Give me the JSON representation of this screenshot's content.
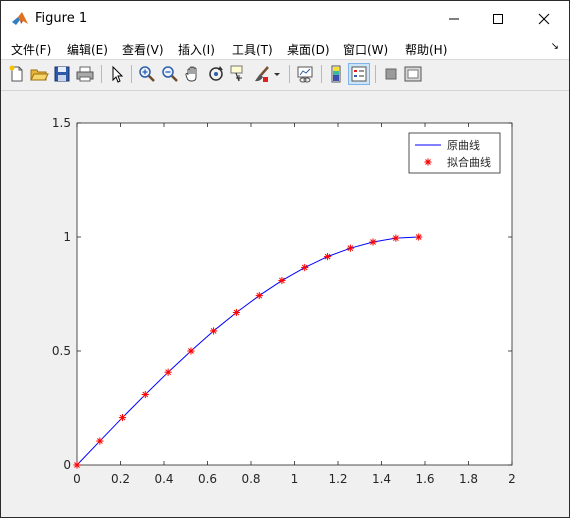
{
  "window": {
    "title": "Figure 1",
    "app_icon": "matlab-logo-icon",
    "controls": [
      "minimize-icon",
      "maximize-icon",
      "close-icon"
    ]
  },
  "menubar": {
    "items": [
      {
        "label": "文件(F)"
      },
      {
        "label": "编辑(E)"
      },
      {
        "label": "查看(V)"
      },
      {
        "label": "插入(I)"
      },
      {
        "label": "工具(T)"
      },
      {
        "label": "桌面(D)"
      },
      {
        "label": "窗口(W)"
      },
      {
        "label": "帮助(H)"
      }
    ],
    "dock_arrow": "↘"
  },
  "toolbar": {
    "buttons": [
      "new-figure-icon",
      "open-file-icon",
      "save-icon",
      "print-icon",
      "pointer-icon",
      "zoom-in-icon",
      "zoom-out-icon",
      "pan-hand-icon",
      "rotate-3d-icon",
      "data-cursor-icon",
      "brush-icon",
      "brush-dropdown-icon",
      "link-plot-icon",
      "colorbar-icon",
      "legend-icon",
      "hide-plot-tools-icon",
      "show-plot-tools-icon"
    ],
    "active_button": "legend-icon"
  },
  "colors": {
    "line": "#0000ff",
    "marker": "#ff0000",
    "axes_bg": "#ffffff",
    "figure_bg": "#f0f0f0"
  },
  "chart_data": {
    "type": "line",
    "title": "",
    "xlabel": "",
    "ylabel": "",
    "xlim": [
      0,
      2
    ],
    "ylim": [
      0,
      1.5
    ],
    "xticks": [
      "0",
      "0.2",
      "0.4",
      "0.6",
      "0.8",
      "1",
      "1.2",
      "1.4",
      "1.6",
      "1.8",
      "2"
    ],
    "yticks": [
      "0",
      "0.5",
      "1",
      "1.5"
    ],
    "grid": false,
    "legend_position": "top-right",
    "series": [
      {
        "name": "原曲线",
        "style": "line",
        "color": "#0000ff",
        "x": [
          0,
          0.105,
          0.209,
          0.314,
          0.419,
          0.524,
          0.628,
          0.733,
          0.838,
          0.942,
          1.047,
          1.152,
          1.257,
          1.361,
          1.466,
          1.571
        ],
        "y": [
          0,
          0.105,
          0.208,
          0.309,
          0.407,
          0.5,
          0.588,
          0.669,
          0.743,
          0.809,
          0.866,
          0.914,
          0.951,
          0.978,
          0.995,
          1.0
        ]
      },
      {
        "name": "拟合曲线",
        "style": "markers",
        "marker": "*",
        "color": "#ff0000",
        "x": [
          0,
          0.105,
          0.209,
          0.314,
          0.419,
          0.524,
          0.628,
          0.733,
          0.838,
          0.942,
          1.047,
          1.152,
          1.257,
          1.361,
          1.466,
          1.571
        ],
        "y": [
          0,
          0.105,
          0.208,
          0.309,
          0.407,
          0.5,
          0.588,
          0.669,
          0.743,
          0.809,
          0.866,
          0.914,
          0.951,
          0.978,
          0.995,
          1.0
        ]
      }
    ]
  }
}
